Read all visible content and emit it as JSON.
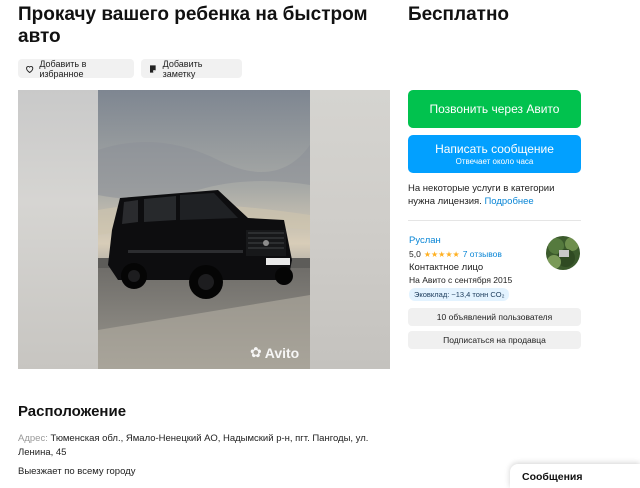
{
  "listing": {
    "title": "Прокачу вашего ребенка на быстром авто",
    "price": "Бесплатно",
    "add_favorite_label": "Добавить в избранное",
    "add_note_label": "Добавить заметку",
    "watermark": "Avito"
  },
  "contact": {
    "call_label": "Позвонить через Авито",
    "message_label": "Написать сообщение",
    "message_sub": "Отвечает около часа",
    "license_text": "На некоторые услуги в категории нужна лицензия.",
    "license_link": "Подробнее"
  },
  "seller": {
    "name": "Руслан",
    "rating": "5,0",
    "stars": "★★★★★",
    "reviews": "7 отзывов",
    "type": "Контактное лицо",
    "since": "На Авито с сентября 2015",
    "eco_badge": "Эковклад: ~13,4 тонн CO₂",
    "ads_label": "10 объявлений пользователя",
    "subscribe_label": "Подписаться на продавца"
  },
  "location": {
    "heading": "Расположение",
    "address_label": "Адрес:",
    "address": "Тюменская обл., Ямало-Ненецкий АО, Надымский р-н, пгт. Пангоды, ул. Ленина, 45",
    "travel_note": "Выезжает по всему городу"
  },
  "messages_tab": "Сообщения",
  "colors": {
    "call_green": "#01c24e",
    "message_blue": "#02a0ff",
    "link_blue": "#0a86d6",
    "star_yellow": "#ffb021"
  }
}
